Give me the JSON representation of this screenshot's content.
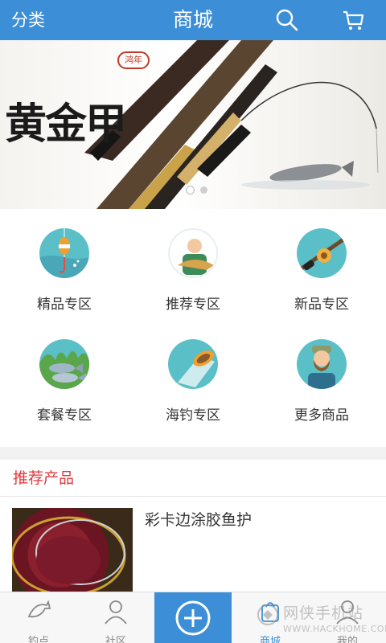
{
  "header": {
    "left_label": "分类",
    "title": "商城",
    "search_icon": "search-icon",
    "cart_icon": "cart-icon",
    "bg_color": "#3c8fd6"
  },
  "banner": {
    "brand_text": "黄金甲",
    "seal_text": "鸿年",
    "slides": 2,
    "active_slide": 1
  },
  "categories": [
    {
      "label": "精品专区",
      "icon": "float-bobber-icon"
    },
    {
      "label": "推荐专区",
      "icon": "fisherman-icon"
    },
    {
      "label": "新品专区",
      "icon": "fishing-reel-icon"
    },
    {
      "label": "套餐专区",
      "icon": "fish-pair-icon"
    },
    {
      "label": "海钓专区",
      "icon": "boat-icon"
    },
    {
      "label": "更多商品",
      "icon": "bearded-man-icon"
    }
  ],
  "section": {
    "title": "推荐产品",
    "title_color": "#e0393e"
  },
  "products": [
    {
      "name": "彩卡边涂胶鱼护"
    }
  ],
  "tabbar": {
    "items": [
      {
        "label": "钓点",
        "icon": "fish-icon"
      },
      {
        "label": "社区",
        "icon": "people-icon"
      },
      {
        "label": "",
        "icon": "plus-circle-icon"
      },
      {
        "label": "商城",
        "icon": "shop-icon"
      },
      {
        "label": "我的",
        "icon": "user-icon"
      }
    ],
    "active_index": 3
  },
  "watermark": {
    "line1": "网侠手机站",
    "line2": "WWW.HACKHOME.COM"
  }
}
